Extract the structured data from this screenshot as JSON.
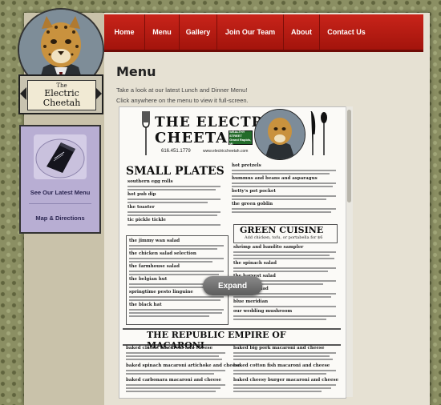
{
  "nav": {
    "items": [
      {
        "label": "Home"
      },
      {
        "label": "Menu"
      },
      {
        "label": "Gallery"
      },
      {
        "label": "Join Our Team"
      },
      {
        "label": "About"
      },
      {
        "label": "Contact Us"
      }
    ]
  },
  "logo": {
    "the": "The",
    "line1": "Electric",
    "line2": "Cheetah"
  },
  "sidebar": {
    "see_menu": "See Our Latest Menu",
    "map": "Map & Directions"
  },
  "page": {
    "title": "Menu",
    "intro_1": "Take a look at our latest Lunch and Dinner Menu!",
    "intro_2": "Click anywhere on the menu to view it full-screen."
  },
  "menu_doc": {
    "title_1": "THE ELECTRIC",
    "title_2": "CHEETAH",
    "phone": "616.451.1779",
    "website": "www.electriccheetah.com",
    "street_badge": "WEALTHY STREET",
    "street_sub": "Grand Rapids, MI",
    "small_plates": "SMALL PLATES",
    "green_cuisine": "GREEN CUISINE",
    "green_sub": "Add chicken, tofu, or portabella for $6",
    "macaroni": "THE REPUBLIC EMPIRE OF MACARONI",
    "left_items": [
      "southern egg rolls",
      "hot pub dip",
      "the toaster",
      "tic pickle tickle"
    ],
    "right_items": [
      "hot pretzels",
      "hummus and beans and asparagus",
      "betty's pot pocket",
      "the green goblin"
    ],
    "sandwich_items": [
      "the jimmy wan salad",
      "the chicken salad selection",
      "the farmhouse salad",
      "the belgian hut",
      "springtime pesto linguine",
      "the black hat"
    ],
    "green_items": [
      "shrimp and bandito sampler",
      "the spinach salad",
      "the harvest salad",
      "the beer salad",
      "blue meridian",
      "our wedding mushroom"
    ],
    "mac_items": [
      "baked classic macaroni and cheese",
      "baked spinach macaroni artichoke and cheese",
      "baked carbonara macaroni and cheese",
      "baked big pork macaroni and cheese",
      "baked cotton fish macaroni and cheese",
      "baked cheesy burger macaroni and cheese"
    ]
  },
  "expand_label": "Expand"
}
